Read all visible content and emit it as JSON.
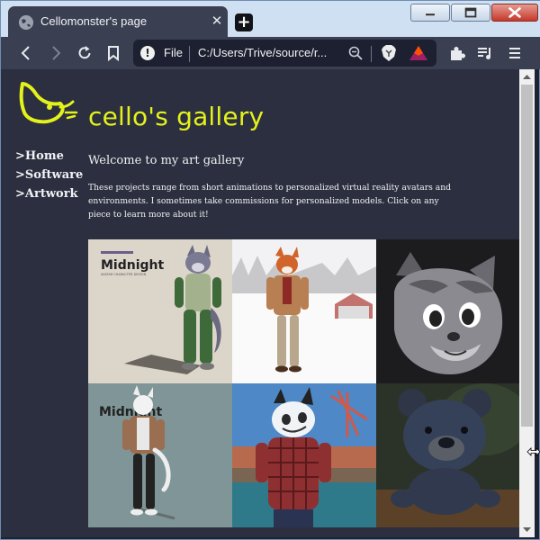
{
  "tab": {
    "title": "Cellomonster's page",
    "close": "✕",
    "new_tab": "+",
    "favicon": "globe-icon"
  },
  "window_controls": [
    "minimize",
    "maximize",
    "close"
  ],
  "toolbar": {
    "icons": [
      "back-icon",
      "forward-icon",
      "reload-icon",
      "bookmark-icon",
      "extensions-icon",
      "playlist-icon",
      "menu-icon"
    ]
  },
  "address_bar": {
    "scheme_label": "File",
    "url": "C:/Users/Trive/source/r...",
    "info_icon_glyph": "!"
  },
  "site": {
    "title": "cello's gallery",
    "accent_color": "#e4f21b",
    "nav": [
      ">Home",
      ">Software",
      ">Artwork"
    ],
    "welcome": "Welcome to my art gallery",
    "intro": "These projects range from short animations to personalized virtual reality avatars and environments. I sometimes take commissions for personalized models. Click on any piece to learn more about it!"
  },
  "gallery": [
    {
      "name": "midnight-wolf",
      "caption": "Midnight",
      "subcaption": "AVATAR CHARACTER DESIGN"
    },
    {
      "name": "fox-in-snow"
    },
    {
      "name": "gray-wolf-portrait"
    },
    {
      "name": "midnight-white-cat",
      "caption": "Midnight"
    },
    {
      "name": "husky-vr-room"
    },
    {
      "name": "knit-teddy-bear"
    }
  ]
}
